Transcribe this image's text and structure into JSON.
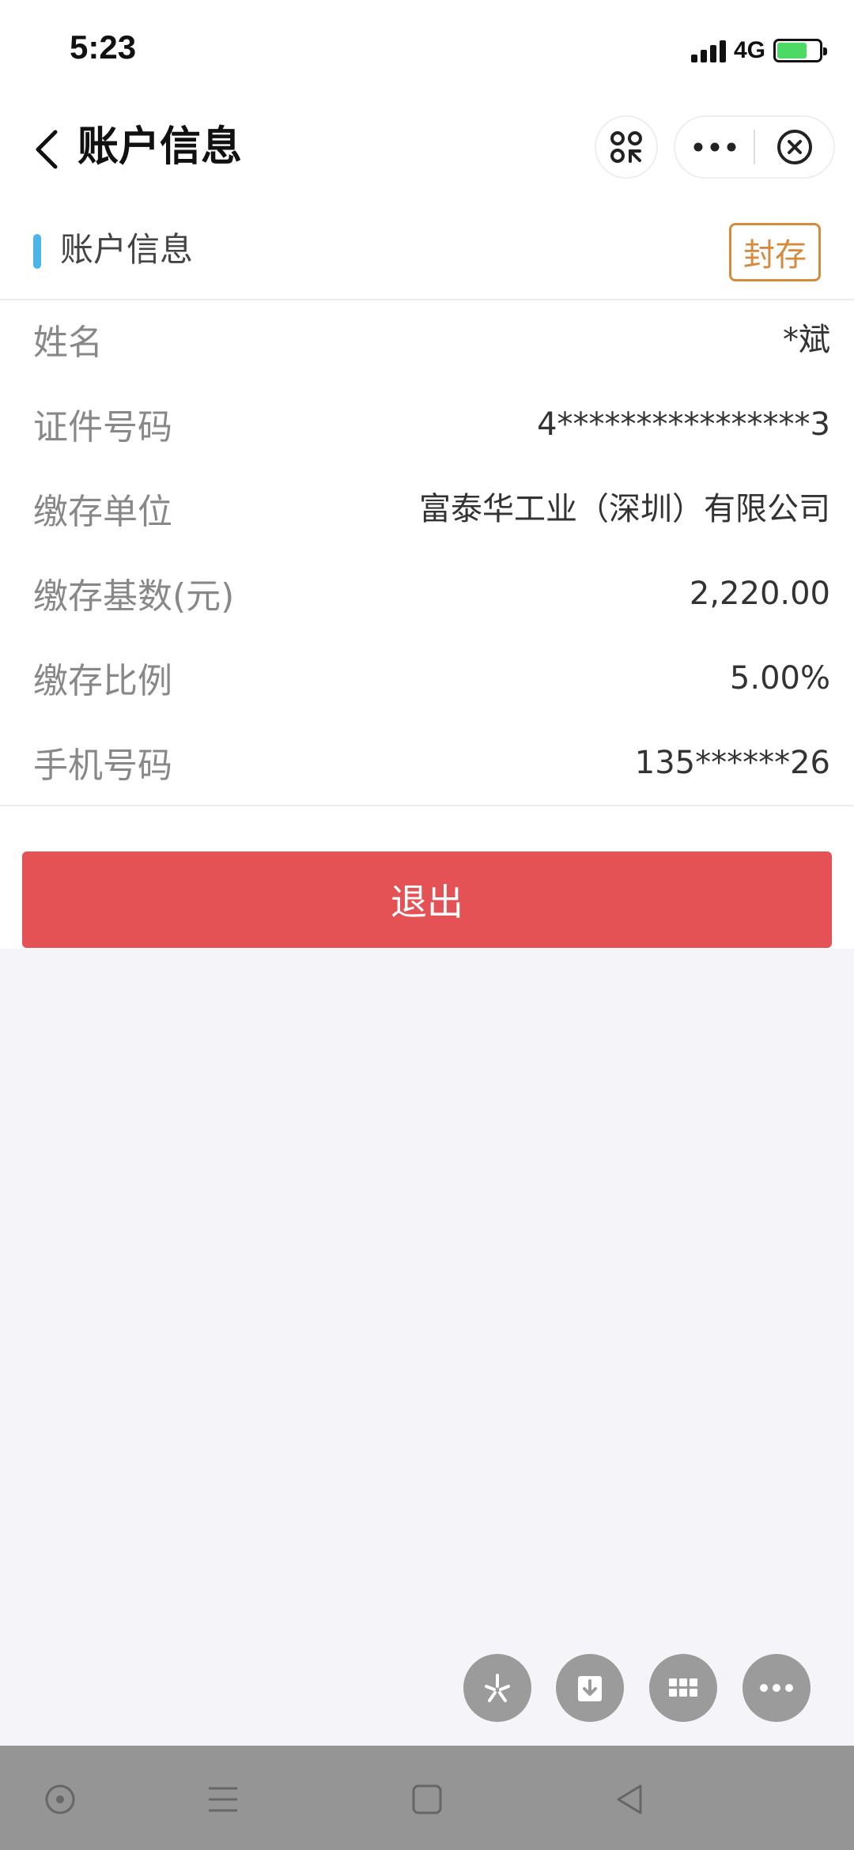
{
  "status_bar": {
    "time": "5:23",
    "network": "4G"
  },
  "nav": {
    "title": "账户信息"
  },
  "section": {
    "title": "账户信息",
    "seal_label": "封存",
    "accent_color": "#4db4e8"
  },
  "info": {
    "rows": [
      {
        "label": "姓名",
        "value": "*斌"
      },
      {
        "label": "证件号码",
        "value": "4****************3"
      },
      {
        "label": "缴存单位",
        "value": "富泰华工业（深圳）有限公司"
      },
      {
        "label": "缴存基数(元)",
        "value": "2,220.00"
      },
      {
        "label": "缴存比例",
        "value": "5.00%"
      },
      {
        "label": "手机号码",
        "value": "135******26"
      }
    ]
  },
  "logout": {
    "label": "退出",
    "color": "#e45255"
  },
  "floating_buttons": [
    {
      "icon": "sparkle-icon"
    },
    {
      "icon": "download-icon"
    },
    {
      "icon": "grid-icon"
    },
    {
      "icon": "more-icon"
    }
  ],
  "android_nav": [
    {
      "icon": "circle-icon"
    },
    {
      "icon": "menu-icon"
    },
    {
      "icon": "home-square-icon"
    },
    {
      "icon": "back-triangle-icon"
    }
  ]
}
